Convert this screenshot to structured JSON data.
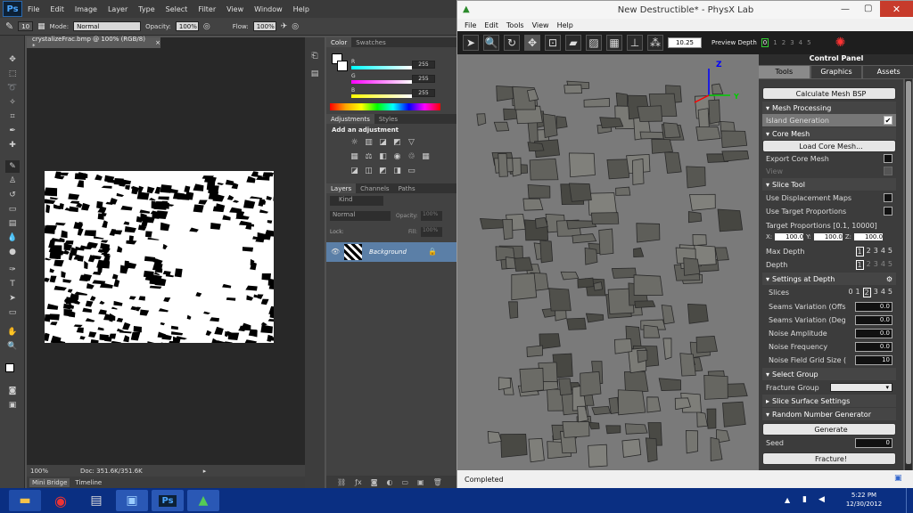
{
  "photoshop": {
    "logo": "Ps",
    "menu": [
      "File",
      "Edit",
      "Image",
      "Layer",
      "Type",
      "Select",
      "Filter",
      "View",
      "Window",
      "Help"
    ],
    "options": {
      "brush_size": "10",
      "mode_label": "Mode:",
      "mode_value": "Normal",
      "opacity_label": "Opacity:",
      "opacity_value": "100%",
      "flow_label": "Flow:",
      "flow_value": "100%"
    },
    "doc_tab": "crystalizeFrac.bmp @ 100% (RGB/8) *",
    "status": {
      "zoom": "100%",
      "doc": "Doc: 351.6K/351.6K"
    },
    "bottom_tabs": [
      "Mini Bridge",
      "Timeline"
    ],
    "color_panel": {
      "tabs": [
        "Color",
        "Swatches"
      ],
      "channels": [
        {
          "label": "R",
          "value": "255"
        },
        {
          "label": "G",
          "value": "255"
        },
        {
          "label": "B",
          "value": "255"
        }
      ]
    },
    "adjustments": {
      "tabs": [
        "Adjustments",
        "Styles"
      ],
      "heading": "Add an adjustment"
    },
    "layers": {
      "tabs": [
        "Layers",
        "Channels",
        "Paths"
      ],
      "kind": "Kind",
      "blend": "Normal",
      "opacity_label": "Opacity:",
      "opacity_value": "100%",
      "lock_label": "Lock:",
      "fill_label": "Fill:",
      "fill_value": "100%",
      "layer_name": "Background"
    }
  },
  "physx": {
    "title": "New Destructible* - PhysX Lab",
    "menu": [
      "File",
      "Edit",
      "Tools",
      "View",
      "Help"
    ],
    "zoom_value": "10.25",
    "preview_depth_label": "Preview Depth",
    "preview_depth_values": [
      "0",
      "1",
      "2",
      "3",
      "4",
      "5"
    ],
    "axis": {
      "z": "Z",
      "y": "Y"
    },
    "panel": {
      "title": "Control Panel",
      "tabs": [
        "Tools",
        "Graphics",
        "Assets"
      ],
      "calc_btn": "Calculate Mesh BSP",
      "mesh_processing": "Mesh Processing",
      "island_generation": "Island Generation",
      "core_mesh": "Core Mesh",
      "load_core": "Load Core Mesh...",
      "export_core": "Export Core Mesh",
      "view": "View",
      "slice_tool": "Slice Tool",
      "use_disp": "Use Displacement Maps",
      "use_target": "Use Target Proportions",
      "target_props": "Target Proportions [0.1, 10000]",
      "x_label": "X:",
      "x_val": "100.0",
      "y_label": "Y:",
      "y_val": "100.0",
      "z_label": "Z:",
      "z_val": "100.0",
      "max_depth": "Max Depth",
      "max_depth_vals": [
        "1",
        "2",
        "3",
        "4",
        "5"
      ],
      "depth": "Depth",
      "depth_vals": [
        "1",
        "2",
        "3",
        "4",
        "5"
      ],
      "settings_depth": "Settings at Depth",
      "slices": "Slices",
      "slices_vals": [
        "0",
        "1",
        "2",
        "3",
        "4",
        "5"
      ],
      "seams_off": "Seams Variation (Offs",
      "seams_off_val": "0.0",
      "seams_deg": "Seams Variation (Deg",
      "seams_deg_val": "0.0",
      "noise_amp": "Noise Amplitude",
      "noise_amp_val": "0.0",
      "noise_freq": "Noise Frequency",
      "noise_freq_val": "0.0",
      "noise_grid": "Noise Field Grid Size (",
      "noise_grid_val": "10",
      "select_group": "Select Group",
      "fracture_group": "Fracture Group",
      "slice_surface": "Slice Surface Settings",
      "rng": "Random Number Generator",
      "generate": "Generate",
      "seed": "Seed",
      "seed_val": "0",
      "fracture": "Fracture!"
    },
    "status": "Completed"
  },
  "taskbar": {
    "time": "5:22 PM",
    "date": "12/30/2012",
    "ps_label": "Ps"
  }
}
